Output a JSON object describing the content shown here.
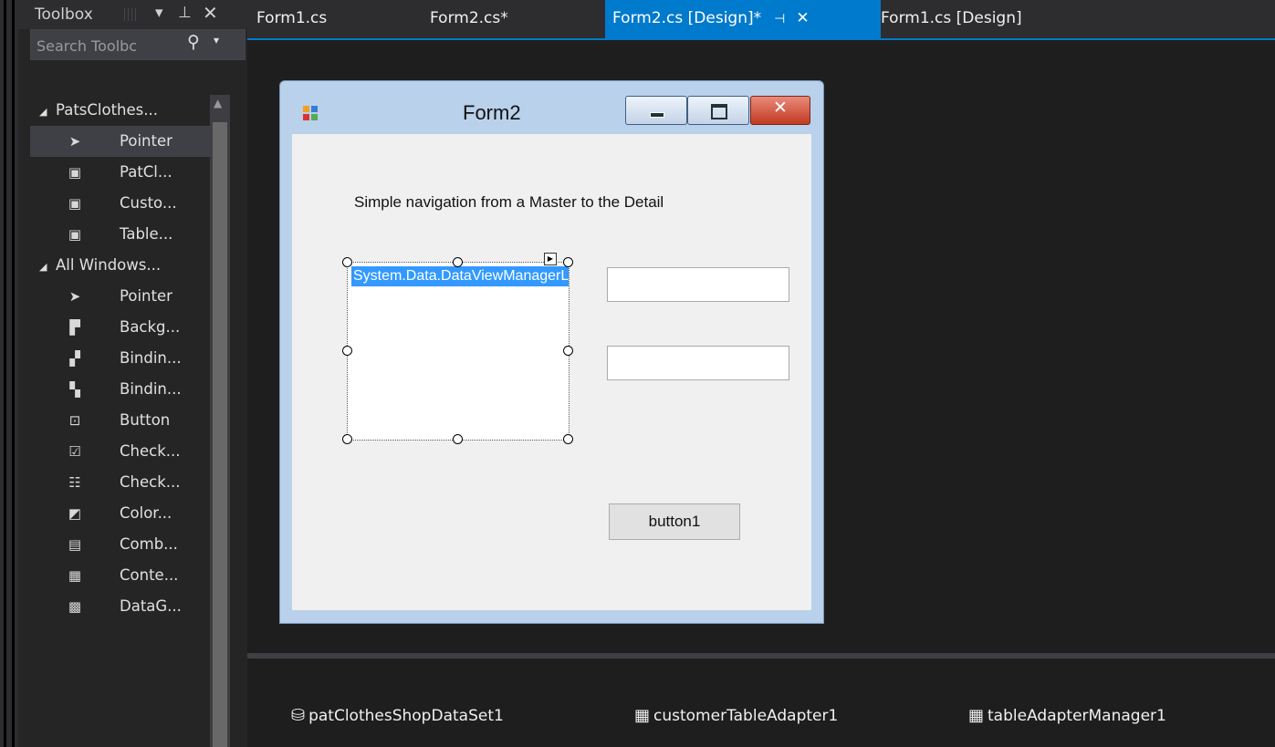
{
  "toolbox": {
    "title": "Toolbox",
    "search_placeholder": "Search Toolbc",
    "groups": [
      {
        "label": "PatsClothes...",
        "items": [
          {
            "label": "Pointer",
            "icon": "pointer-icon",
            "glyph": "➤"
          },
          {
            "label": "PatCl...",
            "icon": "component-icon",
            "glyph": "▣"
          },
          {
            "label": "Custo...",
            "icon": "component-icon",
            "glyph": "▣"
          },
          {
            "label": "Table...",
            "icon": "component-icon",
            "glyph": "▣"
          }
        ]
      },
      {
        "label": "All Windows...",
        "items": [
          {
            "label": "Pointer",
            "icon": "pointer-icon",
            "glyph": "➤"
          },
          {
            "label": "Backg...",
            "icon": "background-worker-icon",
            "glyph": "▛"
          },
          {
            "label": "Bindin...",
            "icon": "binding-navigator-icon",
            "glyph": "▞"
          },
          {
            "label": "Bindin...",
            "icon": "binding-source-icon",
            "glyph": "▚"
          },
          {
            "label": "Button",
            "icon": "button-icon",
            "glyph": "⊡"
          },
          {
            "label": "Check...",
            "icon": "checkbox-icon",
            "glyph": "☑"
          },
          {
            "label": "Check...",
            "icon": "checked-listbox-icon",
            "glyph": "☷"
          },
          {
            "label": "Color...",
            "icon": "color-dialog-icon",
            "glyph": "◩"
          },
          {
            "label": "Comb...",
            "icon": "combobox-icon",
            "glyph": "▤"
          },
          {
            "label": "Conte...",
            "icon": "context-menu-icon",
            "glyph": "▦"
          },
          {
            "label": "DataG...",
            "icon": "datagrid-icon",
            "glyph": "▩"
          }
        ]
      }
    ]
  },
  "tabs": [
    {
      "label": "Form1.cs",
      "active": false
    },
    {
      "label": "Form2.cs*",
      "active": false
    },
    {
      "label": "Form2.cs [Design]*",
      "active": true
    },
    {
      "label": "Form1.cs [Design]",
      "active": false
    }
  ],
  "form": {
    "title": "Form2",
    "label_text": "Simple navigation from a Master to the Detail",
    "listbox_item": "System.Data.DataViewManagerListItemTypeDescriptor",
    "button_label": "button1"
  },
  "tray": [
    {
      "label": "patClothesShopDataSet1",
      "icon": "dataset-icon"
    },
    {
      "label": "customerTableAdapter1",
      "icon": "table-adapter-icon"
    },
    {
      "label": "tableAdapterManager1",
      "icon": "table-adapter-icon"
    }
  ],
  "colors": {
    "accent": "#007acc",
    "background": "#1e1e1e",
    "panel": "#252526"
  }
}
